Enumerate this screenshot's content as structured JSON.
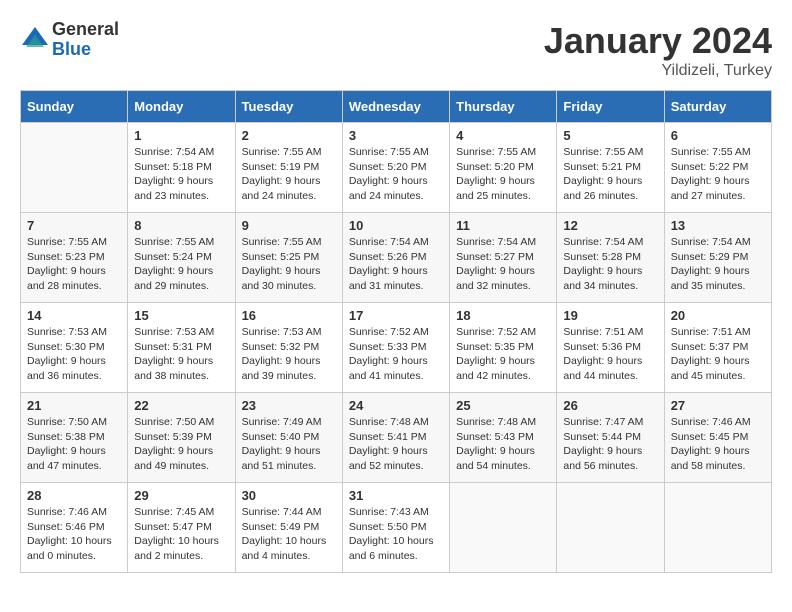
{
  "header": {
    "logo_general": "General",
    "logo_blue": "Blue",
    "month": "January 2024",
    "location": "Yildizeli, Turkey"
  },
  "weekdays": [
    "Sunday",
    "Monday",
    "Tuesday",
    "Wednesday",
    "Thursday",
    "Friday",
    "Saturday"
  ],
  "weeks": [
    [
      {
        "day": "",
        "sunrise": "",
        "sunset": "",
        "daylight": ""
      },
      {
        "day": "1",
        "sunrise": "Sunrise: 7:54 AM",
        "sunset": "Sunset: 5:18 PM",
        "daylight": "Daylight: 9 hours and 23 minutes."
      },
      {
        "day": "2",
        "sunrise": "Sunrise: 7:55 AM",
        "sunset": "Sunset: 5:19 PM",
        "daylight": "Daylight: 9 hours and 24 minutes."
      },
      {
        "day": "3",
        "sunrise": "Sunrise: 7:55 AM",
        "sunset": "Sunset: 5:20 PM",
        "daylight": "Daylight: 9 hours and 24 minutes."
      },
      {
        "day": "4",
        "sunrise": "Sunrise: 7:55 AM",
        "sunset": "Sunset: 5:20 PM",
        "daylight": "Daylight: 9 hours and 25 minutes."
      },
      {
        "day": "5",
        "sunrise": "Sunrise: 7:55 AM",
        "sunset": "Sunset: 5:21 PM",
        "daylight": "Daylight: 9 hours and 26 minutes."
      },
      {
        "day": "6",
        "sunrise": "Sunrise: 7:55 AM",
        "sunset": "Sunset: 5:22 PM",
        "daylight": "Daylight: 9 hours and 27 minutes."
      }
    ],
    [
      {
        "day": "7",
        "sunrise": "Sunrise: 7:55 AM",
        "sunset": "Sunset: 5:23 PM",
        "daylight": "Daylight: 9 hours and 28 minutes."
      },
      {
        "day": "8",
        "sunrise": "Sunrise: 7:55 AM",
        "sunset": "Sunset: 5:24 PM",
        "daylight": "Daylight: 9 hours and 29 minutes."
      },
      {
        "day": "9",
        "sunrise": "Sunrise: 7:55 AM",
        "sunset": "Sunset: 5:25 PM",
        "daylight": "Daylight: 9 hours and 30 minutes."
      },
      {
        "day": "10",
        "sunrise": "Sunrise: 7:54 AM",
        "sunset": "Sunset: 5:26 PM",
        "daylight": "Daylight: 9 hours and 31 minutes."
      },
      {
        "day": "11",
        "sunrise": "Sunrise: 7:54 AM",
        "sunset": "Sunset: 5:27 PM",
        "daylight": "Daylight: 9 hours and 32 minutes."
      },
      {
        "day": "12",
        "sunrise": "Sunrise: 7:54 AM",
        "sunset": "Sunset: 5:28 PM",
        "daylight": "Daylight: 9 hours and 34 minutes."
      },
      {
        "day": "13",
        "sunrise": "Sunrise: 7:54 AM",
        "sunset": "Sunset: 5:29 PM",
        "daylight": "Daylight: 9 hours and 35 minutes."
      }
    ],
    [
      {
        "day": "14",
        "sunrise": "Sunrise: 7:53 AM",
        "sunset": "Sunset: 5:30 PM",
        "daylight": "Daylight: 9 hours and 36 minutes."
      },
      {
        "day": "15",
        "sunrise": "Sunrise: 7:53 AM",
        "sunset": "Sunset: 5:31 PM",
        "daylight": "Daylight: 9 hours and 38 minutes."
      },
      {
        "day": "16",
        "sunrise": "Sunrise: 7:53 AM",
        "sunset": "Sunset: 5:32 PM",
        "daylight": "Daylight: 9 hours and 39 minutes."
      },
      {
        "day": "17",
        "sunrise": "Sunrise: 7:52 AM",
        "sunset": "Sunset: 5:33 PM",
        "daylight": "Daylight: 9 hours and 41 minutes."
      },
      {
        "day": "18",
        "sunrise": "Sunrise: 7:52 AM",
        "sunset": "Sunset: 5:35 PM",
        "daylight": "Daylight: 9 hours and 42 minutes."
      },
      {
        "day": "19",
        "sunrise": "Sunrise: 7:51 AM",
        "sunset": "Sunset: 5:36 PM",
        "daylight": "Daylight: 9 hours and 44 minutes."
      },
      {
        "day": "20",
        "sunrise": "Sunrise: 7:51 AM",
        "sunset": "Sunset: 5:37 PM",
        "daylight": "Daylight: 9 hours and 45 minutes."
      }
    ],
    [
      {
        "day": "21",
        "sunrise": "Sunrise: 7:50 AM",
        "sunset": "Sunset: 5:38 PM",
        "daylight": "Daylight: 9 hours and 47 minutes."
      },
      {
        "day": "22",
        "sunrise": "Sunrise: 7:50 AM",
        "sunset": "Sunset: 5:39 PM",
        "daylight": "Daylight: 9 hours and 49 minutes."
      },
      {
        "day": "23",
        "sunrise": "Sunrise: 7:49 AM",
        "sunset": "Sunset: 5:40 PM",
        "daylight": "Daylight: 9 hours and 51 minutes."
      },
      {
        "day": "24",
        "sunrise": "Sunrise: 7:48 AM",
        "sunset": "Sunset: 5:41 PM",
        "daylight": "Daylight: 9 hours and 52 minutes."
      },
      {
        "day": "25",
        "sunrise": "Sunrise: 7:48 AM",
        "sunset": "Sunset: 5:43 PM",
        "daylight": "Daylight: 9 hours and 54 minutes."
      },
      {
        "day": "26",
        "sunrise": "Sunrise: 7:47 AM",
        "sunset": "Sunset: 5:44 PM",
        "daylight": "Daylight: 9 hours and 56 minutes."
      },
      {
        "day": "27",
        "sunrise": "Sunrise: 7:46 AM",
        "sunset": "Sunset: 5:45 PM",
        "daylight": "Daylight: 9 hours and 58 minutes."
      }
    ],
    [
      {
        "day": "28",
        "sunrise": "Sunrise: 7:46 AM",
        "sunset": "Sunset: 5:46 PM",
        "daylight": "Daylight: 10 hours and 0 minutes."
      },
      {
        "day": "29",
        "sunrise": "Sunrise: 7:45 AM",
        "sunset": "Sunset: 5:47 PM",
        "daylight": "Daylight: 10 hours and 2 minutes."
      },
      {
        "day": "30",
        "sunrise": "Sunrise: 7:44 AM",
        "sunset": "Sunset: 5:49 PM",
        "daylight": "Daylight: 10 hours and 4 minutes."
      },
      {
        "day": "31",
        "sunrise": "Sunrise: 7:43 AM",
        "sunset": "Sunset: 5:50 PM",
        "daylight": "Daylight: 10 hours and 6 minutes."
      },
      {
        "day": "",
        "sunrise": "",
        "sunset": "",
        "daylight": ""
      },
      {
        "day": "",
        "sunrise": "",
        "sunset": "",
        "daylight": ""
      },
      {
        "day": "",
        "sunrise": "",
        "sunset": "",
        "daylight": ""
      }
    ]
  ]
}
